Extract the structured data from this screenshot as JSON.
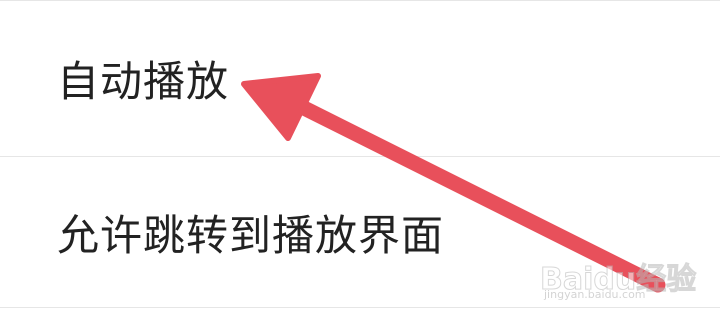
{
  "settings": {
    "items": [
      {
        "label": "自动播放"
      },
      {
        "label": "允许跳转到播放界面"
      }
    ]
  },
  "annotation": {
    "arrow_color": "#e8505b",
    "arrow_target": "自动播放"
  },
  "watermark": {
    "brand": "Baidu经验",
    "url": "jingyan.baidu.com"
  }
}
